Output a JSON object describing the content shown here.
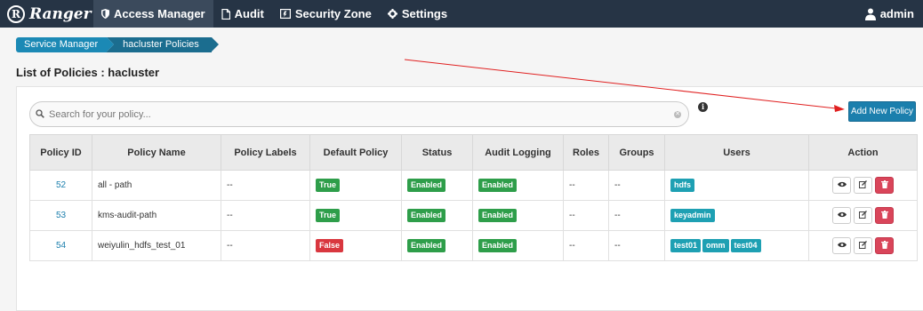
{
  "nav": {
    "brand": "Ranger",
    "brand_logo_letter": "R",
    "items": [
      {
        "label": "Access Manager",
        "icon": "shield-icon"
      },
      {
        "label": "Audit",
        "icon": "file-icon"
      },
      {
        "label": "Security Zone",
        "icon": "zone-icon"
      },
      {
        "label": "Settings",
        "icon": "gear-icon"
      }
    ],
    "user": "admin"
  },
  "breadcrumb": [
    "Service Manager",
    "hacluster Policies"
  ],
  "page_title": "List of Policies : hacluster",
  "search": {
    "placeholder": "Search for your policy...",
    "value": ""
  },
  "add_button_label": "Add New Policy",
  "table": {
    "headers": [
      "Policy ID",
      "Policy Name",
      "Policy Labels",
      "Default Policy",
      "Status",
      "Audit Logging",
      "Roles",
      "Groups",
      "Users",
      "Action"
    ],
    "rows": [
      {
        "id": "52",
        "name": "all - path",
        "labels": "--",
        "default": "True",
        "status": "Enabled",
        "audit": "Enabled",
        "roles": "--",
        "groups": "--",
        "users": [
          "hdfs"
        ]
      },
      {
        "id": "53",
        "name": "kms-audit-path",
        "labels": "--",
        "default": "True",
        "status": "Enabled",
        "audit": "Enabled",
        "roles": "--",
        "groups": "--",
        "users": [
          "keyadmin"
        ]
      },
      {
        "id": "54",
        "name": "weiyulin_hdfs_test_01",
        "labels": "--",
        "default": "False",
        "status": "Enabled",
        "audit": "Enabled",
        "roles": "--",
        "groups": "--",
        "users": [
          "test01",
          "omm",
          "test04"
        ]
      }
    ]
  },
  "colors": {
    "nav_bg": "#263445",
    "accent": "#1b7fad",
    "success": "#2e9e4a",
    "danger": "#d9373f",
    "user_badge": "#1ea0b3",
    "annotation_arrow": "#e02020"
  }
}
